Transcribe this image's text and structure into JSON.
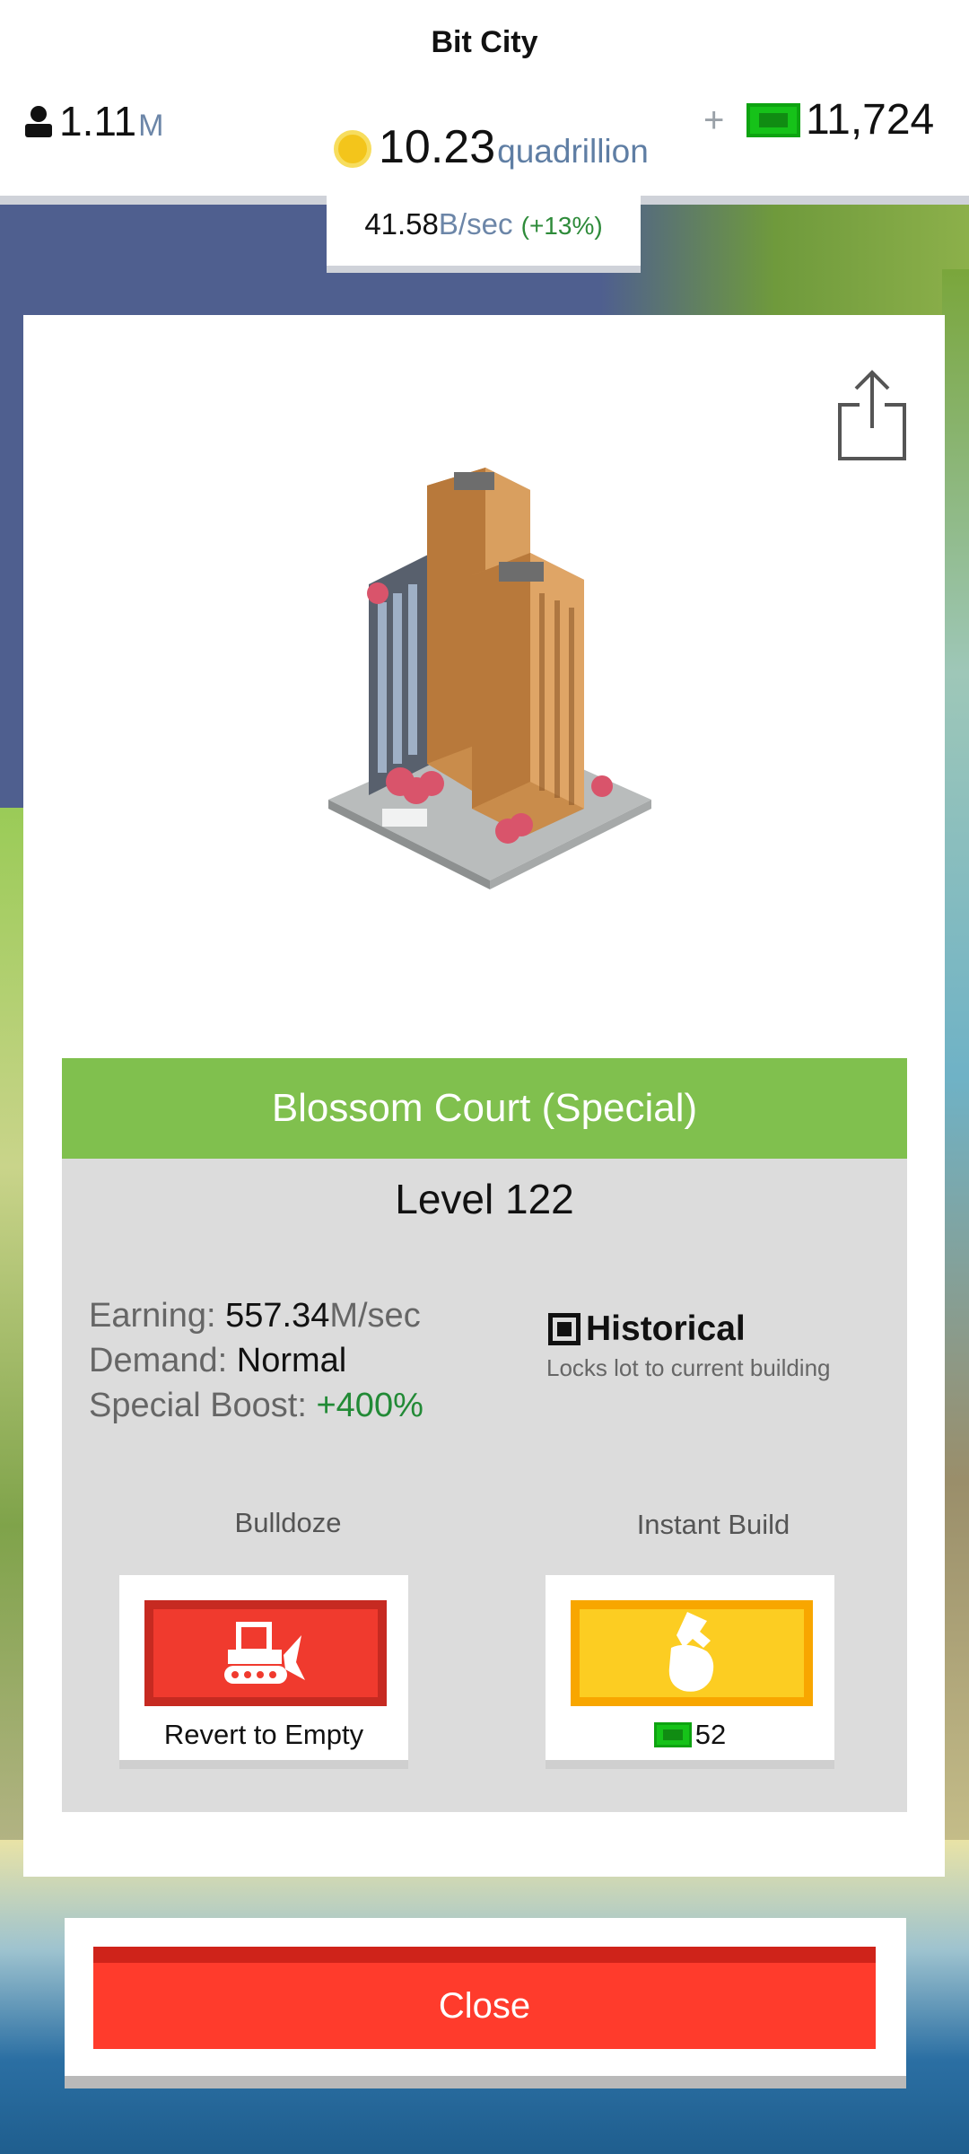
{
  "header": {
    "title": "Bit City",
    "population": {
      "value": "1.11",
      "unit": "M"
    },
    "coins": {
      "value": "10.23",
      "unit": "quadrillion"
    },
    "plus": "+",
    "cash": "11,724",
    "rate": {
      "value": "41.58",
      "unit": "B/sec",
      "boost": "(+13%)"
    }
  },
  "building": {
    "name": "Blossom Court (Special)",
    "level": "Level 122",
    "earning": {
      "label": "Earning:",
      "value": "557.34",
      "unit": "M/sec"
    },
    "demand": {
      "label": "Demand:",
      "value": "Normal"
    },
    "special_boost": {
      "label": "Special Boost:",
      "value": "+400%"
    },
    "historical": {
      "label": "Historical",
      "description": "Locks lot to current building",
      "checked": true
    }
  },
  "actions": {
    "bulldoze": {
      "label": "Bulldoze",
      "caption": "Revert to Empty",
      "icon": "bulldozer-icon"
    },
    "instant_build": {
      "label": "Instant Build",
      "cost": "52",
      "icon": "hammer-hand-icon"
    }
  },
  "close_label": "Close",
  "colors": {
    "green_bar": "#80c04e",
    "red_button": "#f03a2e",
    "yellow_button": "#fccd22",
    "cash_green": "#16c219",
    "boost_green": "#228a36"
  }
}
